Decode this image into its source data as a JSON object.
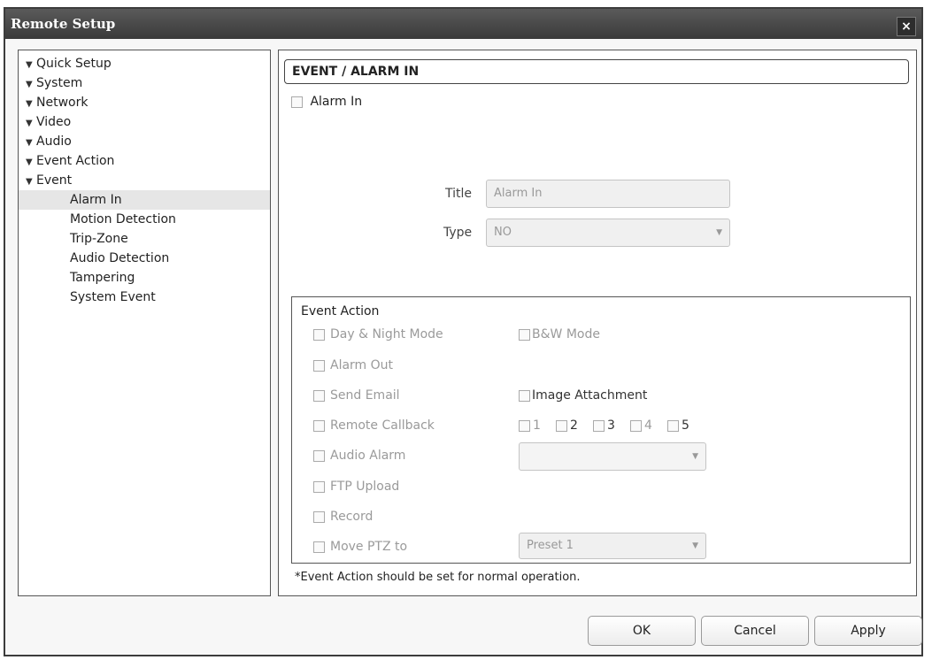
{
  "window": {
    "title": "Remote Setup",
    "close_glyph": "×"
  },
  "nav": {
    "items": [
      {
        "label": "Quick Setup",
        "expandable": true
      },
      {
        "label": "System",
        "expandable": true
      },
      {
        "label": "Network",
        "expandable": true
      },
      {
        "label": "Video",
        "expandable": true
      },
      {
        "label": "Audio",
        "expandable": true
      },
      {
        "label": "Event Action",
        "expandable": true
      },
      {
        "label": "Event",
        "expandable": true
      }
    ],
    "sub_items": [
      {
        "label": "Alarm In",
        "selected": true
      },
      {
        "label": "Motion Detection"
      },
      {
        "label": "Trip-Zone"
      },
      {
        "label": "Audio Detection"
      },
      {
        "label": "Tampering"
      },
      {
        "label": "System Event"
      }
    ]
  },
  "content": {
    "section_title": "EVENT / ALARM IN",
    "enable_label": "Alarm In",
    "title_label": "Title",
    "title_value": "Alarm In",
    "type_label": "Type",
    "type_value": "NO",
    "event_action": {
      "heading": "Event Action",
      "day_night": "Day & Night Mode",
      "bw_mode": "B&W Mode",
      "alarm_out": "Alarm Out",
      "send_email": "Send Email",
      "image_attachment": "Image Attachment",
      "remote_callback": "Remote Callback",
      "callback_numbers": [
        "1",
        "2",
        "3",
        "4",
        "5"
      ],
      "audio_alarm": "Audio Alarm",
      "audio_alarm_value": "",
      "ftp_upload": "FTP Upload",
      "record": "Record",
      "move_ptz": "Move PTZ to",
      "ptz_preset": "Preset 1"
    },
    "note": "*Event Action should be set for normal operation."
  },
  "buttons": {
    "ok": "OK",
    "cancel": "Cancel",
    "apply": "Apply"
  }
}
